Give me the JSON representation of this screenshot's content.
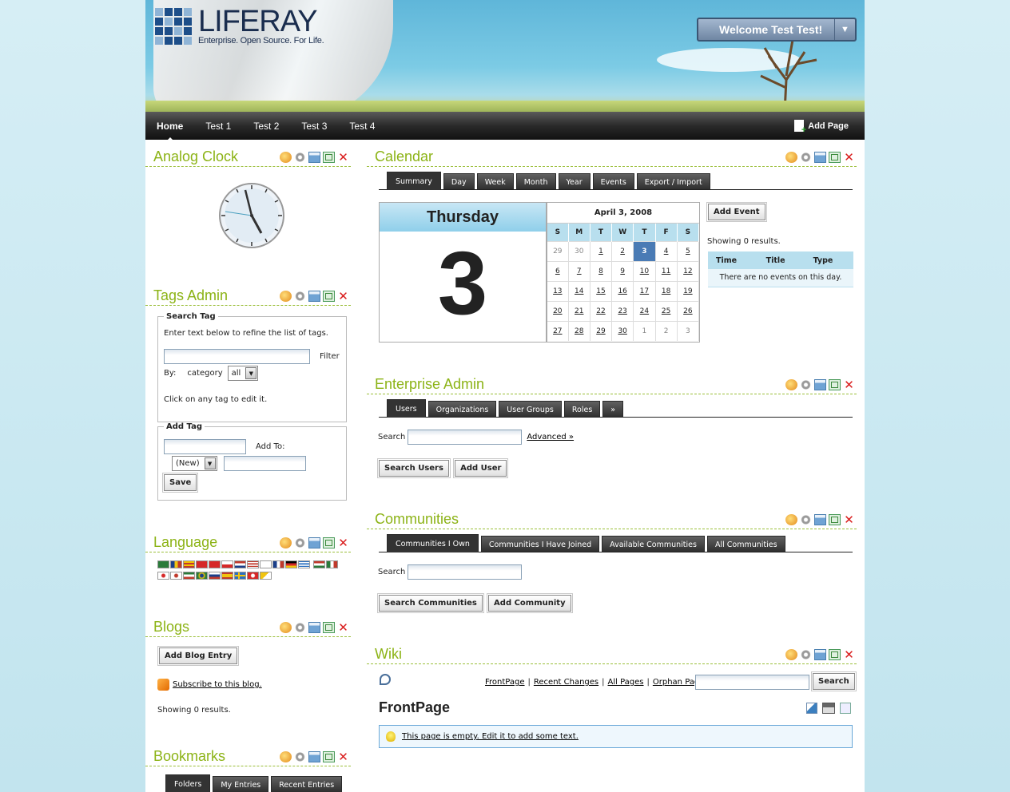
{
  "header": {
    "logo_name": "LIFERAY",
    "logo_tagline": "Enterprise. Open Source. For Life.",
    "welcome": "Welcome Test Test!"
  },
  "nav": {
    "items": [
      "Home",
      "Test 1",
      "Test 2",
      "Test 3",
      "Test 4"
    ],
    "selected": "Home",
    "add_page": "Add Page"
  },
  "portlets": {
    "clock": {
      "title": "Analog Clock"
    },
    "tags": {
      "title": "Tags Admin",
      "search_legend": "Search Tag",
      "search_hint": "Enter text below to refine the list of tags.",
      "filter_label": "Filter",
      "by_label": "By:",
      "category_label": "category",
      "category_value": "all",
      "click_hint": "Click on any tag to edit it.",
      "add_legend": "Add Tag",
      "add_to_label": "Add To:",
      "new_value": "(New)",
      "save": "Save"
    },
    "language": {
      "title": "Language"
    },
    "blogs": {
      "title": "Blogs",
      "add_entry": "Add Blog Entry",
      "subscribe": "Subscribe to this blog.",
      "showing": "Showing 0 results."
    },
    "bookmarks": {
      "title": "Bookmarks",
      "tabs": [
        "Folders",
        "My Entries",
        "Recent Entries"
      ]
    },
    "calendar": {
      "title": "Calendar",
      "tabs": [
        "Summary",
        "Day",
        "Week",
        "Month",
        "Year",
        "Events",
        "Export / Import"
      ],
      "day_name": "Thursday",
      "day_number": "3",
      "month_title": "April 3, 2008",
      "weekdays": [
        "S",
        "M",
        "T",
        "W",
        "T",
        "F",
        "S"
      ],
      "add_event": "Add Event",
      "showing": "Showing 0 results.",
      "columns": [
        "Time",
        "Title",
        "Type"
      ],
      "empty": "There are no events on this day."
    },
    "enterprise": {
      "title": "Enterprise Admin",
      "tabs": [
        "Users",
        "Organizations",
        "User Groups",
        "Roles",
        "»"
      ],
      "search_label": "Search",
      "advanced": "Advanced »",
      "search_users": "Search Users",
      "add_user": "Add User"
    },
    "communities": {
      "title": "Communities",
      "tabs": [
        "Communities I Own",
        "Communities I Have Joined",
        "Available Communities",
        "All Communities"
      ],
      "search_label": "Search",
      "search_btn": "Search Communities",
      "add_btn": "Add Community"
    },
    "wiki": {
      "title": "Wiki",
      "links": [
        "FrontPage",
        "Recent Changes",
        "All Pages",
        "Orphan Pages"
      ],
      "search_btn": "Search",
      "page_title": "FrontPage",
      "empty_msg": "This page is empty. Edit it to add some text."
    }
  },
  "colors": {
    "title_green": "#8cb316",
    "nav_dark": "#2a2a2a",
    "today_blue": "#4a7bb5"
  }
}
